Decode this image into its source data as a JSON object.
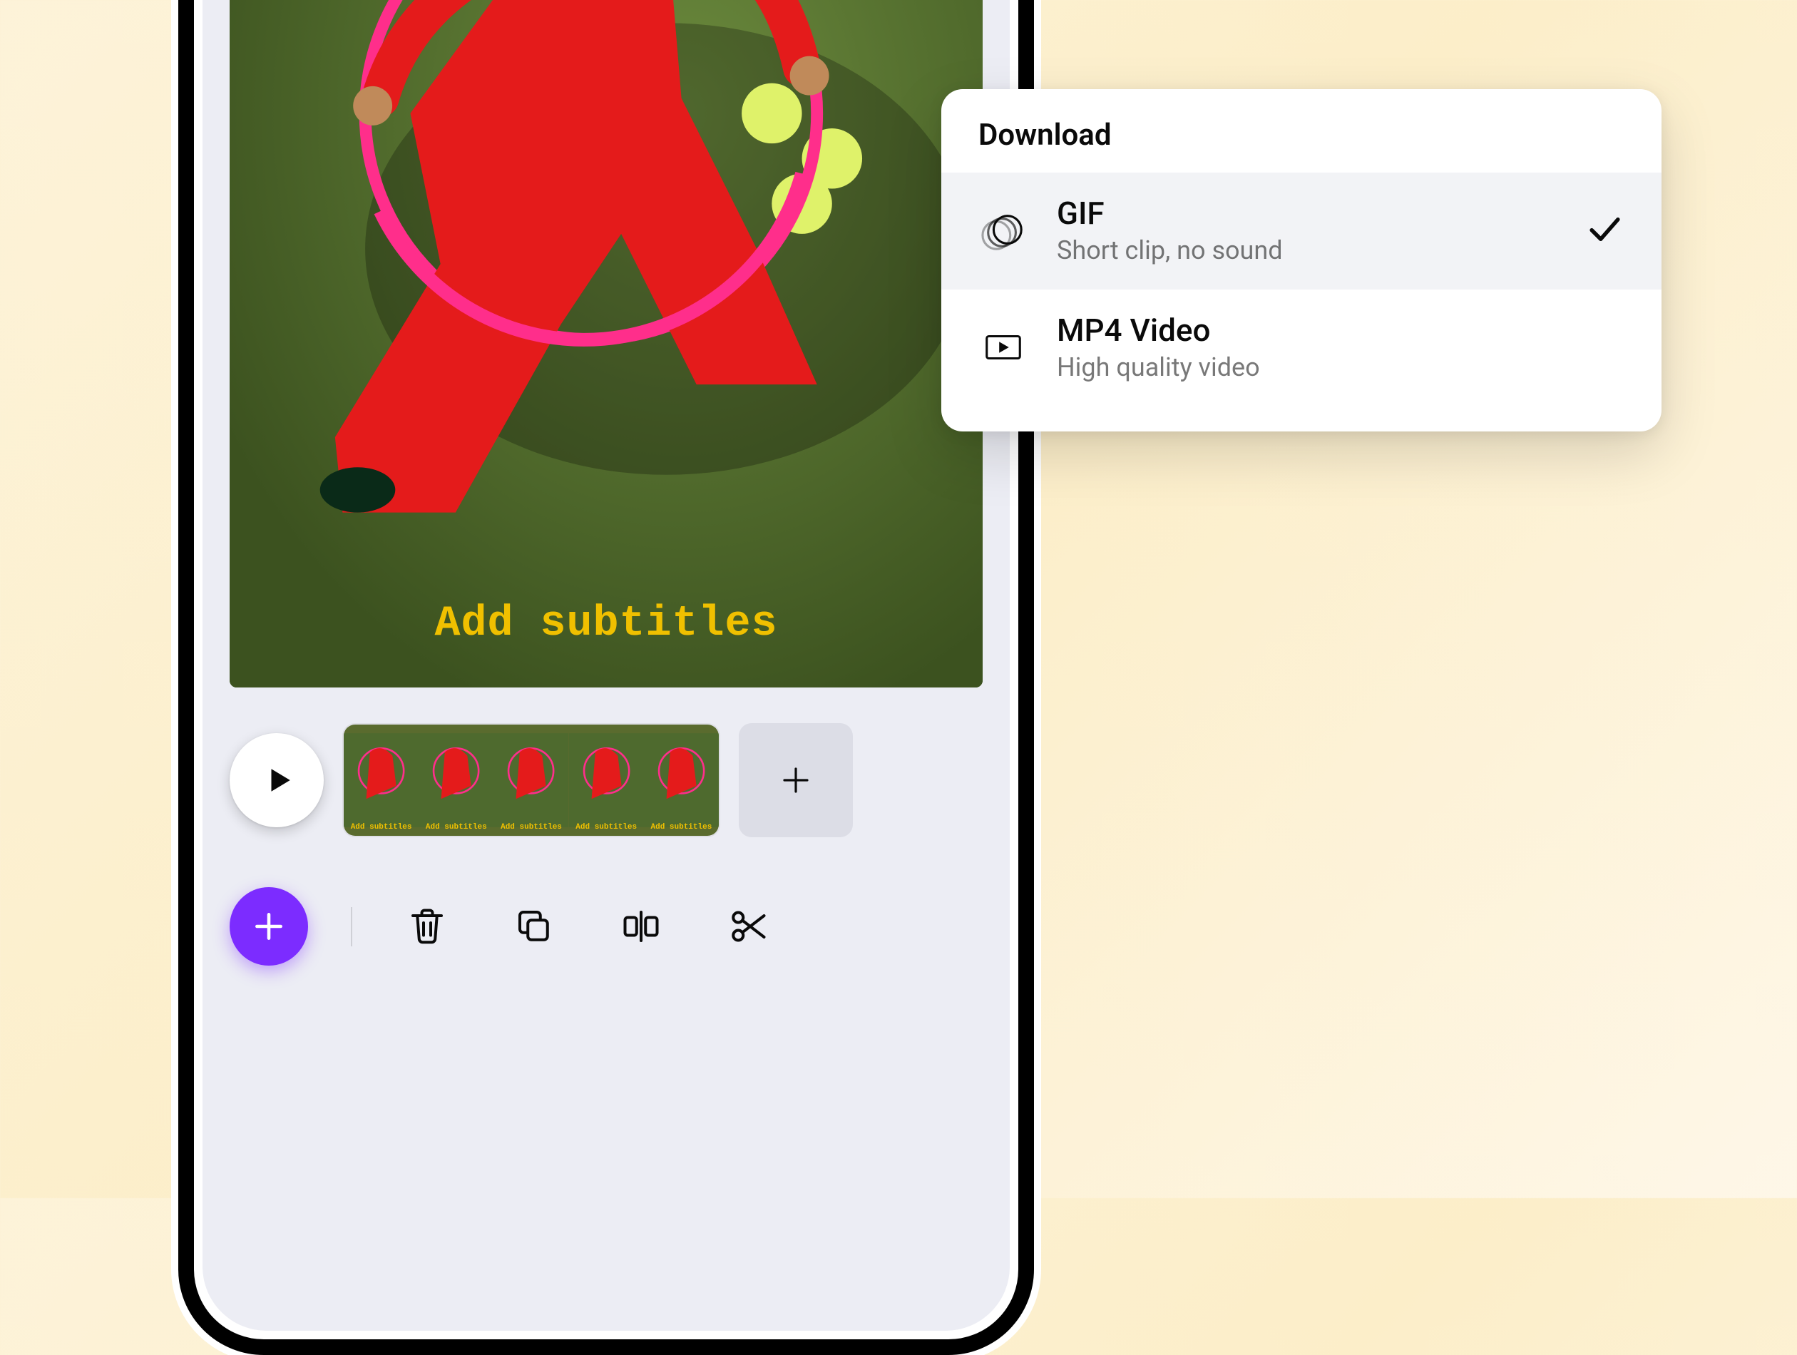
{
  "preview": {
    "subtitle_text": "Add subtitles"
  },
  "timeline": {
    "thumb_label": "Add subtitles"
  },
  "popover": {
    "title": "Download",
    "options": [
      {
        "title": "GIF",
        "subtitle": "Short clip, no sound",
        "selected": true
      },
      {
        "title": "MP4 Video",
        "subtitle": "High quality video",
        "selected": false
      }
    ]
  }
}
